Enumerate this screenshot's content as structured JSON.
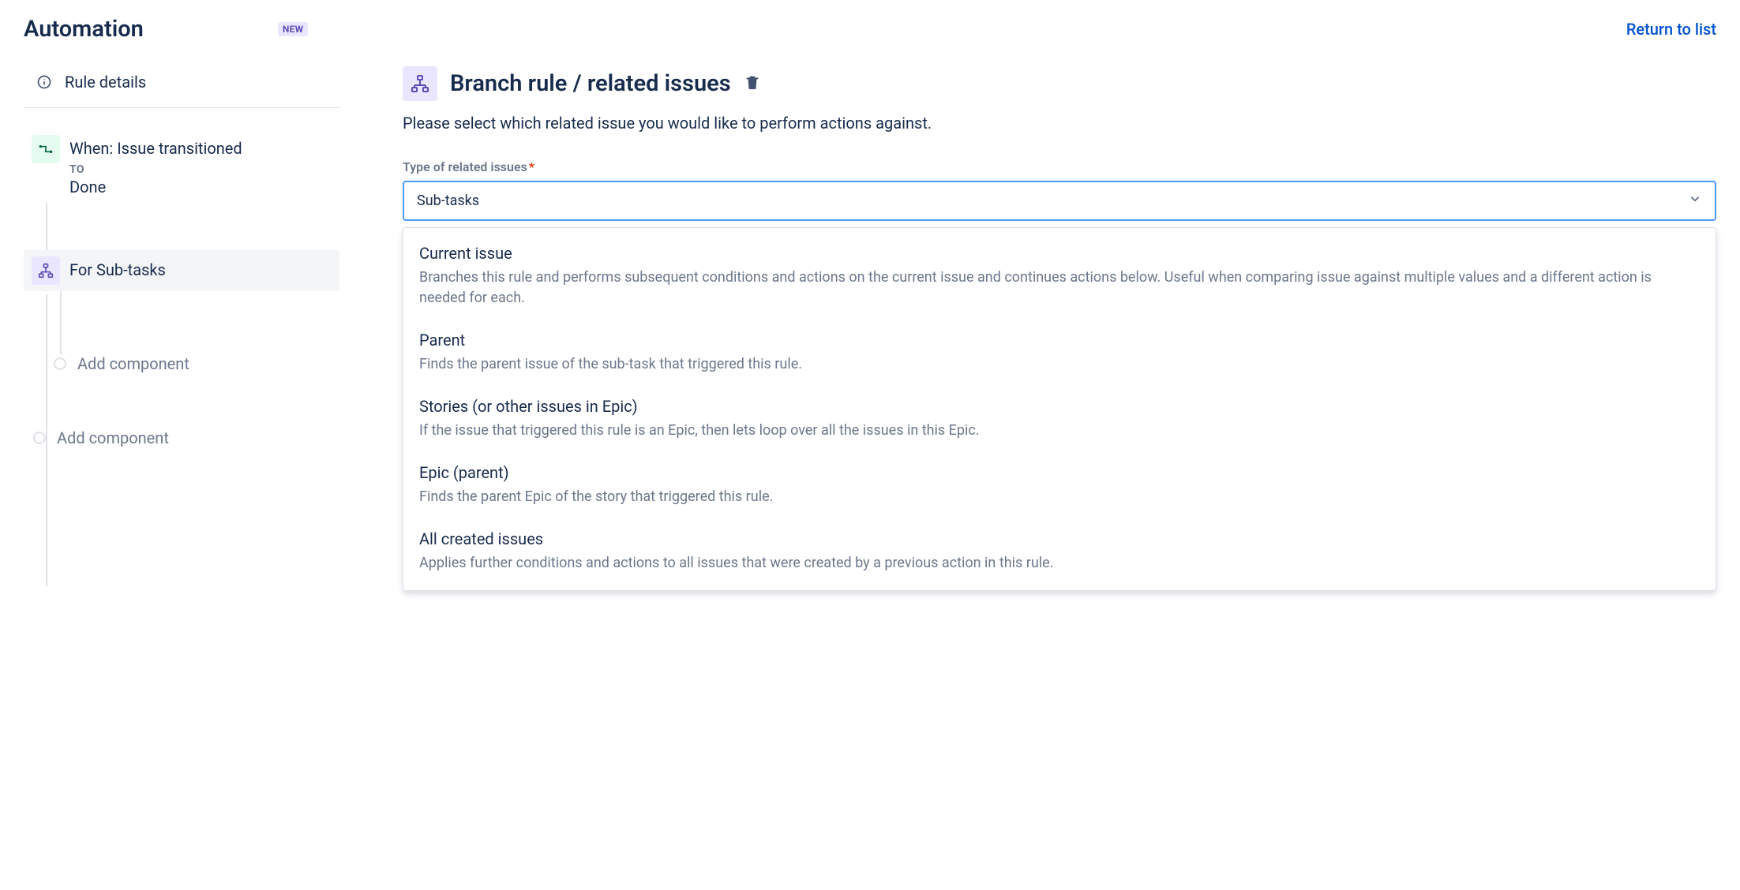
{
  "header": {
    "title": "Automation",
    "badge": "NEW",
    "return_link": "Return to list"
  },
  "sidebar": {
    "rule_details_label": "Rule details",
    "trigger": {
      "title": "When: Issue transitioned",
      "to_label": "TO",
      "to_value": "Done"
    },
    "branch": {
      "title": "For Sub-tasks"
    },
    "add_component_label": "Add component"
  },
  "main": {
    "title": "Branch rule / related issues",
    "description": "Please select which related issue you would like to perform actions against.",
    "field_label": "Type of related issues",
    "required_marker": "*",
    "selected_value": "Sub-tasks",
    "options": [
      {
        "title": "Current issue",
        "desc": "Branches this rule and performs subsequent conditions and actions on the current issue and continues actions below. Useful when comparing issue against multiple values and a different action is needed for each."
      },
      {
        "title": "Parent",
        "desc": "Finds the parent issue of the sub-task that triggered this rule."
      },
      {
        "title": "Stories (or other issues in Epic)",
        "desc": "If the issue that triggered this rule is an Epic, then lets loop over all the issues in this Epic."
      },
      {
        "title": "Epic (parent)",
        "desc": "Finds the parent Epic of the story that triggered this rule."
      },
      {
        "title": "All created issues",
        "desc": "Applies further conditions and actions to all issues that were created by a previous action in this rule."
      }
    ]
  }
}
